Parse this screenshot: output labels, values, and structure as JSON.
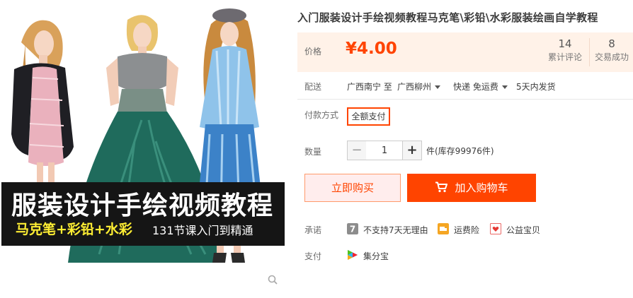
{
  "banner": {
    "title": "服装设计手绘视频教程",
    "subtitle_left": "马克笔+彩铅+水彩",
    "subtitle_right": "131节课入门到精通"
  },
  "product": {
    "title": "入门服装设计手绘视频教程马克笔\\彩铅\\水彩服装绘画自学教程"
  },
  "price": {
    "label": "价格",
    "value": "¥4.00",
    "reviews_count": "14",
    "reviews_label": "累计评论",
    "deals_count": "8",
    "deals_label": "交易成功"
  },
  "delivery": {
    "label": "配送",
    "from": "广西南宁 至",
    "to": "广西柳州",
    "shipping": "快递 免运费",
    "dispatch": "5天内发货"
  },
  "payment_method": {
    "label": "付款方式",
    "option": "全额支付"
  },
  "quantity": {
    "label": "数量",
    "minus": "−",
    "value": "1",
    "plus": "+",
    "stock": "件(库存99976件)"
  },
  "actions": {
    "buy_now": "立即购买",
    "add_to_cart": "加入购物车"
  },
  "promise": {
    "label": "承诺",
    "items": [
      {
        "icon": "seven-day-icon",
        "text": "不支持7天无理由",
        "color": "#8c8c8c"
      },
      {
        "icon": "shipping-insurance-icon",
        "text": "运费险",
        "color": "#f5a623"
      },
      {
        "icon": "charity-icon",
        "text": "公益宝贝",
        "color": "#e53935"
      }
    ]
  },
  "pay": {
    "label": "支付",
    "method": "集分宝"
  },
  "colors": {
    "accent": "#ff4400",
    "price_bg": "#fff2e8",
    "buy_now_bg": "#ffeded"
  }
}
